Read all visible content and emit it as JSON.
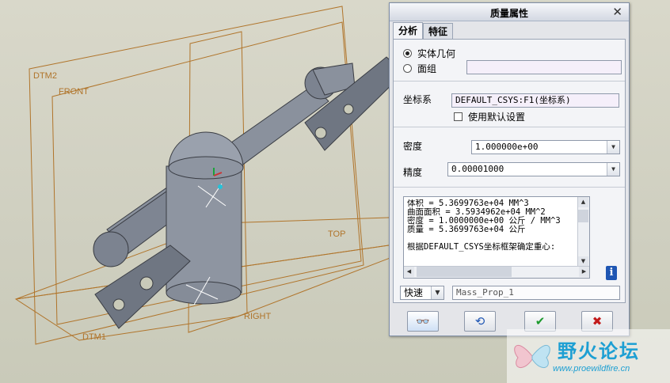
{
  "viewport": {
    "datums": {
      "dtm2": "DTM2",
      "front": "FRONT",
      "top": "TOP",
      "right": "RIGHT",
      "dtm1": "DTM1"
    },
    "colors": {
      "datum": "#b0742a",
      "part": "#7c8390",
      "background": "#d3d3c4"
    }
  },
  "dialog": {
    "title": "质量属性",
    "close_glyph": "✕",
    "tabs": [
      "分析",
      "特征"
    ],
    "geometry_options": {
      "solid": "实体几何",
      "quilt": "面组",
      "selected": "solid"
    },
    "csys": {
      "label": "坐标系",
      "value": "DEFAULT_CSYS:F1(坐标系)",
      "use_default_label": "使用默认设置",
      "use_default_checked": false
    },
    "density": {
      "label": "密度",
      "value": "1.000000e+00"
    },
    "accuracy": {
      "label": "精度",
      "value": "0.00001000"
    },
    "results": [
      "体积 =  5.3699763e+04  MM^3",
      "曲面面积 =  3.5934962e+04  MM^2",
      "密度 =  1.0000000e+00 公斤 / MM^3",
      "质量 =  5.3699763e+04 公斤",
      "",
      "根据DEFAULT_CSYS坐标框架确定重心:"
    ],
    "mode": {
      "value": "快速"
    },
    "feature_name": "Mass_Prop_1",
    "icons": {
      "preview": "glasses-icon",
      "repeat": "refresh-icon",
      "ok": "checkmark-icon",
      "cancel": "x-icon",
      "info": "info-icon"
    },
    "glyphs": {
      "preview": "👓",
      "repeat": "⟲",
      "ok": "✔",
      "cancel": "✖",
      "info": "i",
      "dd": "▼",
      "up": "▲",
      "down": "▼",
      "left": "◀",
      "right": "▶"
    }
  },
  "watermark": {
    "name": "野火论坛",
    "url": "www.proewildfire.cn"
  }
}
